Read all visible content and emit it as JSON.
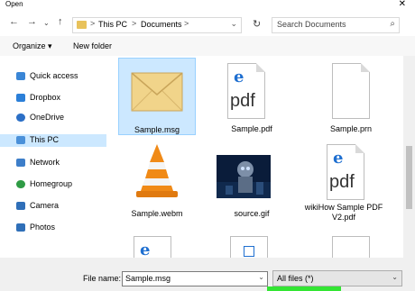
{
  "window": {
    "title": "Open",
    "close_glyph": "✕"
  },
  "nav": {
    "back": "←",
    "forward": "→",
    "up": "↑",
    "path": [
      "This PC",
      "Documents"
    ],
    "separator": ">",
    "refresh": "↻",
    "search_placeholder": "Search Documents"
  },
  "toolbar": {
    "organize": "Organize ▾",
    "new_folder": "New folder"
  },
  "sidebar": {
    "items": [
      {
        "label": "Quick access",
        "icon": "star-icon",
        "color": "#3a86d6"
      },
      {
        "label": "Dropbox",
        "icon": "dropbox-icon",
        "color": "#2b7fd8"
      },
      {
        "label": "OneDrive",
        "icon": "cloud-icon",
        "color": "#2b6fc6"
      },
      {
        "label": "This PC",
        "icon": "computer-icon",
        "color": "#4a90d9",
        "selected": true
      },
      {
        "label": "Network",
        "icon": "network-icon",
        "color": "#3d7ec9"
      },
      {
        "label": "Homegroup",
        "icon": "homegroup-icon",
        "color": "#2f9b45"
      },
      {
        "label": "Camera",
        "icon": "camera-icon",
        "color": "#2f6fb8"
      },
      {
        "label": "Photos",
        "icon": "photos-icon",
        "color": "#2f6fb8"
      }
    ]
  },
  "files": [
    {
      "name": "Sample.msg",
      "kind": "envelope-icon",
      "selected": true
    },
    {
      "name": "Sample.pdf",
      "kind": "pdf-icon"
    },
    {
      "name": "Sample.prn",
      "kind": "blank-doc-icon"
    },
    {
      "name": "Sample.webm",
      "kind": "vlc-cone-icon"
    },
    {
      "name": "source.gif",
      "kind": "gif-thumbnail"
    },
    {
      "name": "wikiHow Sample PDF V2.pdf",
      "kind": "pdf-icon"
    }
  ],
  "pdf_label": "pdf",
  "bottom": {
    "file_name_label": "File name:",
    "file_name_value": "Sample.msg",
    "file_type": "All files (*)",
    "dropdown_glyph": "⌄"
  }
}
